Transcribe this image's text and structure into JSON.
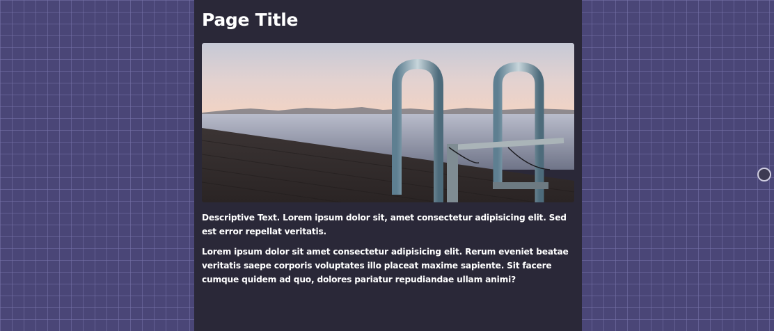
{
  "page": {
    "title": "Page Title",
    "paragraphs": [
      "Descriptive Text. Lorem ipsum dolor sit, amet consectetur adipisicing elit. Sed est error repellat veritatis.",
      "Lorem ipsum dolor sit amet consectetur adipisicing elit. Rerum eveniet beatae veritatis saepe corporis voluptates illo placeat maxime sapiente. Sit facere cumque quidem ad quo, dolores pariatur repudiandae ullam animi?"
    ]
  },
  "colors": {
    "background": "#4a4677",
    "panel": "#2a2838",
    "text": "#ffffff"
  },
  "icons": {
    "right_edge_control": "circle-handle-icon"
  }
}
